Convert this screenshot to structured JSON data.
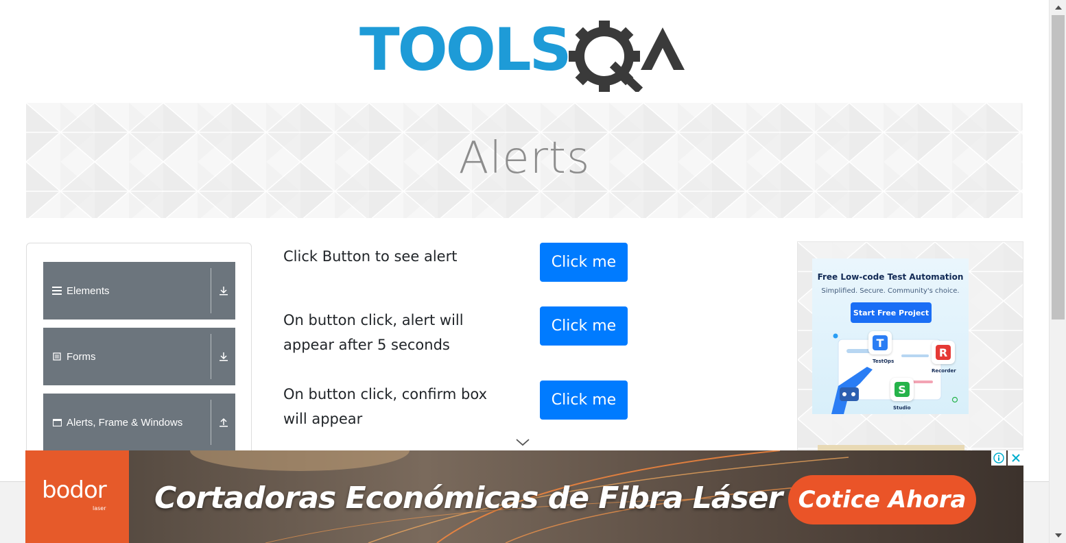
{
  "logo": {
    "text_tools": "TOOLS",
    "text_qa": "QA",
    "blue": "#1e9bd7",
    "dark": "#3a3a3a"
  },
  "banner": {
    "title": "Alerts"
  },
  "sidebar": {
    "groups": [
      {
        "label": "Elements",
        "icon": "menu-icon",
        "arrow": "download-arrow-icon"
      },
      {
        "label": "Forms",
        "icon": "form-icon",
        "arrow": "download-arrow-icon"
      },
      {
        "label": "Alerts, Frame & Windows",
        "icon": "window-icon",
        "arrow": "upload-arrow-icon"
      }
    ]
  },
  "rows": [
    {
      "text": "Click Button to see alert",
      "button": "Click me"
    },
    {
      "text": "On button click, alert will appear after 5 seconds",
      "button": "Click me"
    },
    {
      "text": "On button click, confirm box will appear",
      "button": "Click me"
    }
  ],
  "side_ad": {
    "headline": "Free Low-code Test Automation",
    "sub": "Simplified. Secure. Community's choice.",
    "cta": "Start Free Project",
    "tiles": [
      {
        "letter": "T",
        "label": "TestOps",
        "color": "#2a7df4"
      },
      {
        "letter": "R",
        "label": "Recorder",
        "color": "#e53935"
      },
      {
        "letter": "S",
        "label": "Studio",
        "color": "#25b34a"
      }
    ]
  },
  "bottom_ad": {
    "brand": "bodor",
    "brand_sub": "laser",
    "headline": "Cortadoras Económicas de Fibra Láser",
    "cta": "Cotice Ahora",
    "accent": "#e65a2a"
  },
  "colors": {
    "primary_button": "#007bff",
    "nav_bg": "#6c757d"
  }
}
